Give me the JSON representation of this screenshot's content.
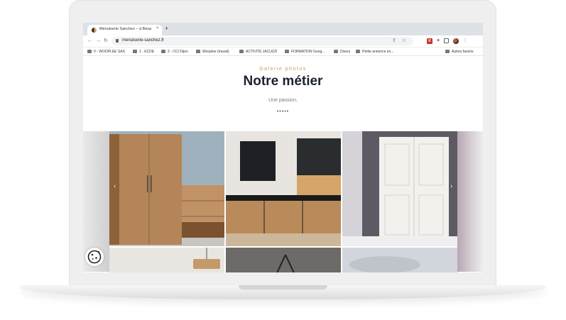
{
  "browser": {
    "tab_title": "Menuiserie Sanchez – à Besa",
    "tab_close": "×",
    "new_tab": "+",
    "url": "menuiserie-sanchez.fr",
    "bookmarks": [
      "0 - WOOPLEE SAS",
      "1 - ECDE",
      "2 - CCI Dijon",
      "Wooplee (travail)",
      "ACTIVITE JACUZZI",
      "FORMATION Goog...",
      "Divers",
      "Petite annonce en...",
      "Autres favoris"
    ]
  },
  "page": {
    "eyebrow": "Galerie photos",
    "heading": "Notre métier",
    "tagline": "Une passion.",
    "dots": "•••••"
  },
  "gallery": {
    "prev_arrow": "‹",
    "next_arrow": "›"
  },
  "colors": {
    "accent": "#c7976a",
    "heading": "#1c2230",
    "wood": "#b9875a"
  },
  "icons": [
    "back-icon",
    "forward-icon",
    "reload-icon",
    "lock-icon",
    "share-icon",
    "star-icon",
    "extensions-icon",
    "profile-icon",
    "menu-icon",
    "cookie-icon"
  ]
}
